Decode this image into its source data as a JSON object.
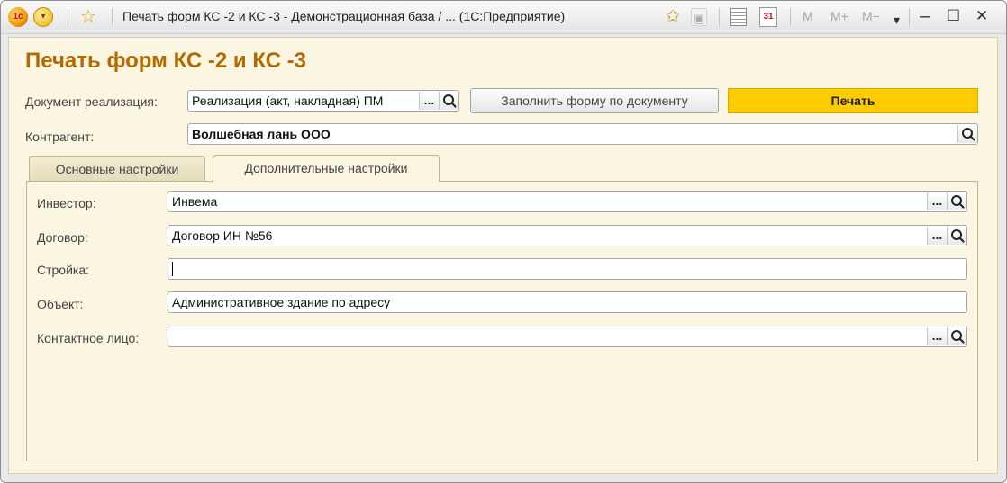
{
  "window": {
    "title": "Печать форм КС -2 и КС -3 - Демонстрационная база / ...  (1С:Предприятие)",
    "logo_text": "1c",
    "memory_buttons": [
      "M",
      "M+",
      "M−"
    ],
    "calendar_day": "31",
    "controls": {
      "dropdown": "▾",
      "minimize": "–",
      "maximize": "☐",
      "close": "✕"
    }
  },
  "form": {
    "title": "Печать форм КС -2 и КС -3",
    "document": {
      "label": "Документ реализация:",
      "value": "Реализация (акт, накладная) ПМ"
    },
    "fill_button": "Заполнить форму по документу",
    "print_button": "Печать",
    "counterparty": {
      "label": "Контрагент:",
      "value": "Волшебная лань ООО"
    },
    "tabs": [
      {
        "label": "Основные настройки",
        "active": false
      },
      {
        "label": "Дополнительные настройки",
        "active": true
      }
    ],
    "additional": {
      "investor": {
        "label": "Инвестор:",
        "value": "Инвема"
      },
      "contract": {
        "label": "Договор:",
        "value": "Договор ИН №56"
      },
      "construction": {
        "label": "Стройка:",
        "value": ""
      },
      "object": {
        "label": "Объект:",
        "value": "Административное здание по адресу"
      },
      "contact": {
        "label": "Контактное лицо:",
        "value": ""
      }
    },
    "select_button_glyph": "..."
  },
  "colors": {
    "accent_title": "#b36b00",
    "print_button": "#ffcc00",
    "form_background": "#fbf6e1"
  },
  "icons": [
    "1c-logo-icon",
    "main-menu-icon",
    "favorites-star-icon",
    "add-to-favorites-icon",
    "bookmark-icon",
    "calculator-icon",
    "calendar-icon",
    "search-icon"
  ]
}
